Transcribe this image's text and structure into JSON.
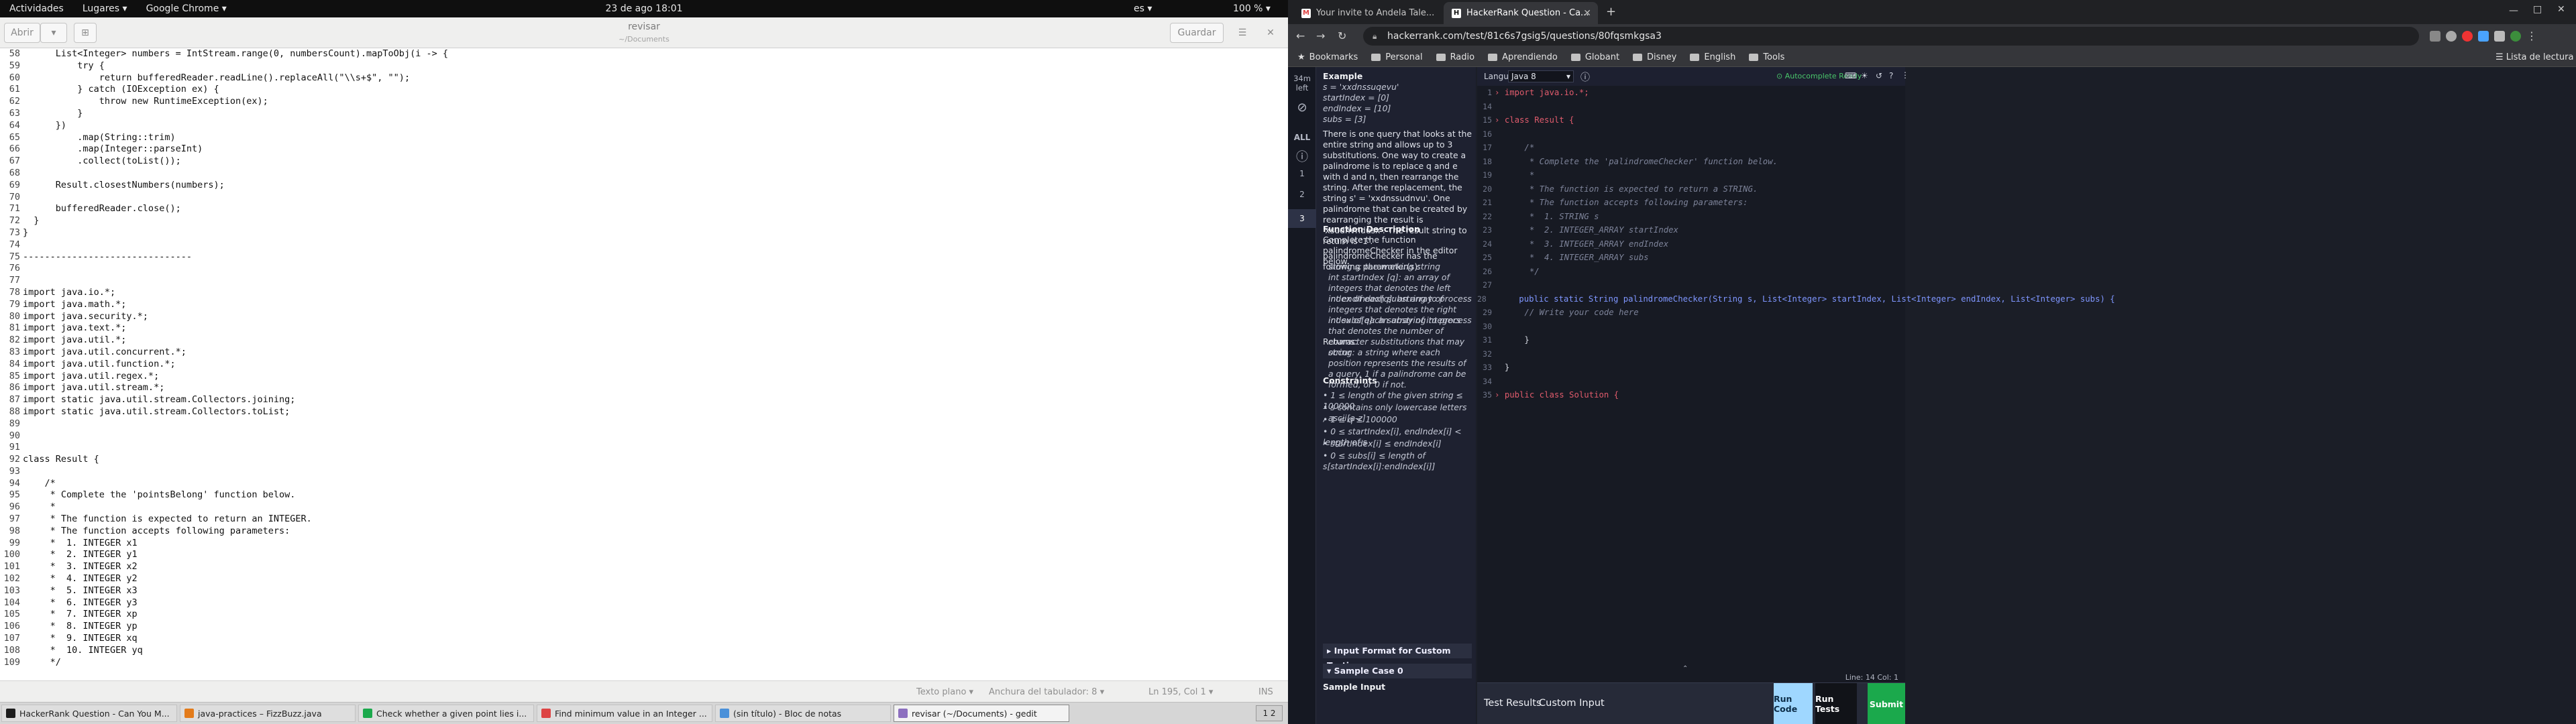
{
  "topbar": {
    "activities": "Actividades",
    "places": "Lugares ▾",
    "app": "Google Chrome ▾",
    "datetime": "23 de ago  18:01",
    "lang": "es ▾",
    "battery": "100 % ▾"
  },
  "gedit": {
    "open": "Abrir",
    "save": "Guardar",
    "title": "revisar",
    "subtitle": "~/Documents",
    "lines": [
      [
        "58",
        "      List<Integer> numbers = IntStream.range(0, numbersCount).mapToObj(i -> {"
      ],
      [
        "59",
        "          try {"
      ],
      [
        "60",
        "              return bufferedReader.readLine().replaceAll(\"\\\\s+$\", \"\");"
      ],
      [
        "61",
        "          } catch (IOException ex) {"
      ],
      [
        "62",
        "              throw new RuntimeException(ex);"
      ],
      [
        "63",
        "          }"
      ],
      [
        "64",
        "      })"
      ],
      [
        "65",
        "          .map(String::trim)"
      ],
      [
        "66",
        "          .map(Integer::parseInt)"
      ],
      [
        "67",
        "          .collect(toList());"
      ],
      [
        "68",
        ""
      ],
      [
        "69",
        "      Result.closestNumbers(numbers);"
      ],
      [
        "70",
        ""
      ],
      [
        "71",
        "      bufferedReader.close();"
      ],
      [
        "72",
        "  }"
      ],
      [
        "73",
        "}"
      ],
      [
        "74",
        ""
      ],
      [
        "75",
        "-------------------------------"
      ],
      [
        "76",
        ""
      ],
      [
        "77",
        ""
      ],
      [
        "78",
        "import java.io.*;"
      ],
      [
        "79",
        "import java.math.*;"
      ],
      [
        "80",
        "import java.security.*;"
      ],
      [
        "81",
        "import java.text.*;"
      ],
      [
        "82",
        "import java.util.*;"
      ],
      [
        "83",
        "import java.util.concurrent.*;"
      ],
      [
        "84",
        "import java.util.function.*;"
      ],
      [
        "85",
        "import java.util.regex.*;"
      ],
      [
        "86",
        "import java.util.stream.*;"
      ],
      [
        "87",
        "import static java.util.stream.Collectors.joining;"
      ],
      [
        "88",
        "import static java.util.stream.Collectors.toList;"
      ],
      [
        "89",
        ""
      ],
      [
        "90",
        ""
      ],
      [
        "91",
        ""
      ],
      [
        "92",
        "class Result {"
      ],
      [
        "93",
        ""
      ],
      [
        "94",
        "    /*"
      ],
      [
        "95",
        "     * Complete the 'pointsBelong' function below."
      ],
      [
        "96",
        "     *"
      ],
      [
        "97",
        "     * The function is expected to return an INTEGER."
      ],
      [
        "98",
        "     * The function accepts following parameters:"
      ],
      [
        "99",
        "     *  1. INTEGER x1"
      ],
      [
        "100",
        "     *  2. INTEGER y1"
      ],
      [
        "101",
        "     *  3. INTEGER x2"
      ],
      [
        "102",
        "     *  4. INTEGER y2"
      ],
      [
        "103",
        "     *  5. INTEGER x3"
      ],
      [
        "104",
        "     *  6. INTEGER y3"
      ],
      [
        "105",
        "     *  7. INTEGER xp"
      ],
      [
        "106",
        "     *  8. INTEGER yp"
      ],
      [
        "107",
        "     *  9. INTEGER xq"
      ],
      [
        "108",
        "     *  10. INTEGER yq"
      ],
      [
        "109",
        "     */"
      ]
    ],
    "status": {
      "syntax": "Texto plano ▾",
      "tab": "Anchura del tabulador: 8 ▾",
      "pos": "Ln 195, Col 1 ▾",
      "ins": "INS"
    }
  },
  "taskbar": {
    "items": [
      "HackerRank Question - Can You M...",
      "java-practices – FizzBuzz.java",
      "Check whether a given point lies i...",
      "Find minimum value in an Integer ...",
      "(sin título) - Bloc de notas",
      "revisar (~/Documents) - gedit"
    ],
    "pager": "1 2"
  },
  "chrome": {
    "tabs": [
      "Your invite to Andela Tale...",
      "HackerRank Question - Ca..."
    ],
    "url": "hackerrank.com/test/81c6s7gsig5/questions/80fqsmkgsa3",
    "bookmarks": [
      "Bookmarks",
      "Personal",
      "Radio",
      "Aprendiendo",
      "Globant",
      "Disney",
      "English",
      "Tools"
    ],
    "reading_list": "Lista de lectura"
  },
  "hr": {
    "time_left": "34m left",
    "all": "ALL",
    "q_numbers": [
      "1",
      "2",
      "3"
    ],
    "example_title": "Example",
    "example_lines": [
      "s = 'xxdnssuqevu'",
      "startIndex = [0]",
      "endIndex = [10]",
      "subs = [3]"
    ],
    "explain": "There is one query that looks at the entire string and allows up to 3 substitutions. One way to create a palindrome is to replace q and e with d and n, then rearrange the string. After the replacement, the string s' = 'xxdnssudnvu'. One palindrome that can be created by rearranging the result is 'xsudnvndusx'. The result string to return is '1'.",
    "func_title": "Function Description",
    "func_desc": "Complete the function palindromeChecker in the editor below.",
    "params_intro": "palindromeChecker has the following parameter(s):",
    "params": [
      "string s: the working string",
      "int startIndex [q]: an array of integers that denotes the left index of each substring to process",
      "int endIndex[q]: an array of integers that denotes the right index of each substring to process",
      "int subs[q]: an array of integers that denotes the number of character substitutions that may occur"
    ],
    "returns_label": "Returns:",
    "returns": "string: a string where each position represents the results of a query, 1 if a palindrome can be formed, or 0 if not.",
    "constraints_title": "Constraints",
    "constraints": [
      "1 ≤ length of the given string ≤ 100000",
      "s contains only lowercase letters , ascii[a-z]",
      "1 ≤ q ≤ 100000",
      "0 ≤ startIndex[i], endIndex[i] < length of s",
      "startIndex[i] ≤ endIndex[i]",
      "0 ≤ subs[i] ≤ length of s[startIndex[i]:endIndex[i]]"
    ],
    "accordion1": "▸  Input Format for Custom Testing",
    "accordion2": "▾  Sample Case 0",
    "sample_input": "Sample Input",
    "language_label": "Language",
    "language": "Java 8",
    "autocomplete": "Autocomplete Ready",
    "code": [
      [
        "1",
        "import java.io.*;",
        "import"
      ],
      [
        "14",
        "",
        ""
      ],
      [
        "15",
        "class Result {",
        "class"
      ],
      [
        "16",
        "",
        ""
      ],
      [
        "17",
        "    /*",
        "comment"
      ],
      [
        "18",
        "     * Complete the 'palindromeChecker' function below.",
        "comment"
      ],
      [
        "19",
        "     *",
        "comment"
      ],
      [
        "20",
        "     * The function is expected to return a STRING.",
        "comment"
      ],
      [
        "21",
        "     * The function accepts following parameters:",
        "comment"
      ],
      [
        "22",
        "     *  1. STRING s",
        "comment"
      ],
      [
        "23",
        "     *  2. INTEGER_ARRAY startIndex",
        "comment"
      ],
      [
        "24",
        "     *  3. INTEGER_ARRAY endIndex",
        "comment"
      ],
      [
        "25",
        "     *  4. INTEGER_ARRAY subs",
        "comment"
      ],
      [
        "26",
        "     */",
        "comment"
      ],
      [
        "27",
        "",
        ""
      ],
      [
        "28",
        "    public static String palindromeChecker(String s, List<Integer> startIndex, List<Integer> endIndex, List<Integer> subs) {",
        "sig"
      ],
      [
        "29",
        "    // Write your code here",
        "comment"
      ],
      [
        "30",
        "",
        ""
      ],
      [
        "31",
        "    }",
        ""
      ],
      [
        "32",
        "",
        ""
      ],
      [
        "33",
        "}",
        ""
      ],
      [
        "34",
        "",
        ""
      ],
      [
        "35",
        "public class Solution {",
        "class2"
      ]
    ],
    "cursor_pos": "Line: 14 Col: 1",
    "test_results": "Test Results",
    "custom_input": "Custom Input",
    "run_code": "Run Code",
    "run_tests": "Run Tests",
    "submit": "Submit"
  }
}
